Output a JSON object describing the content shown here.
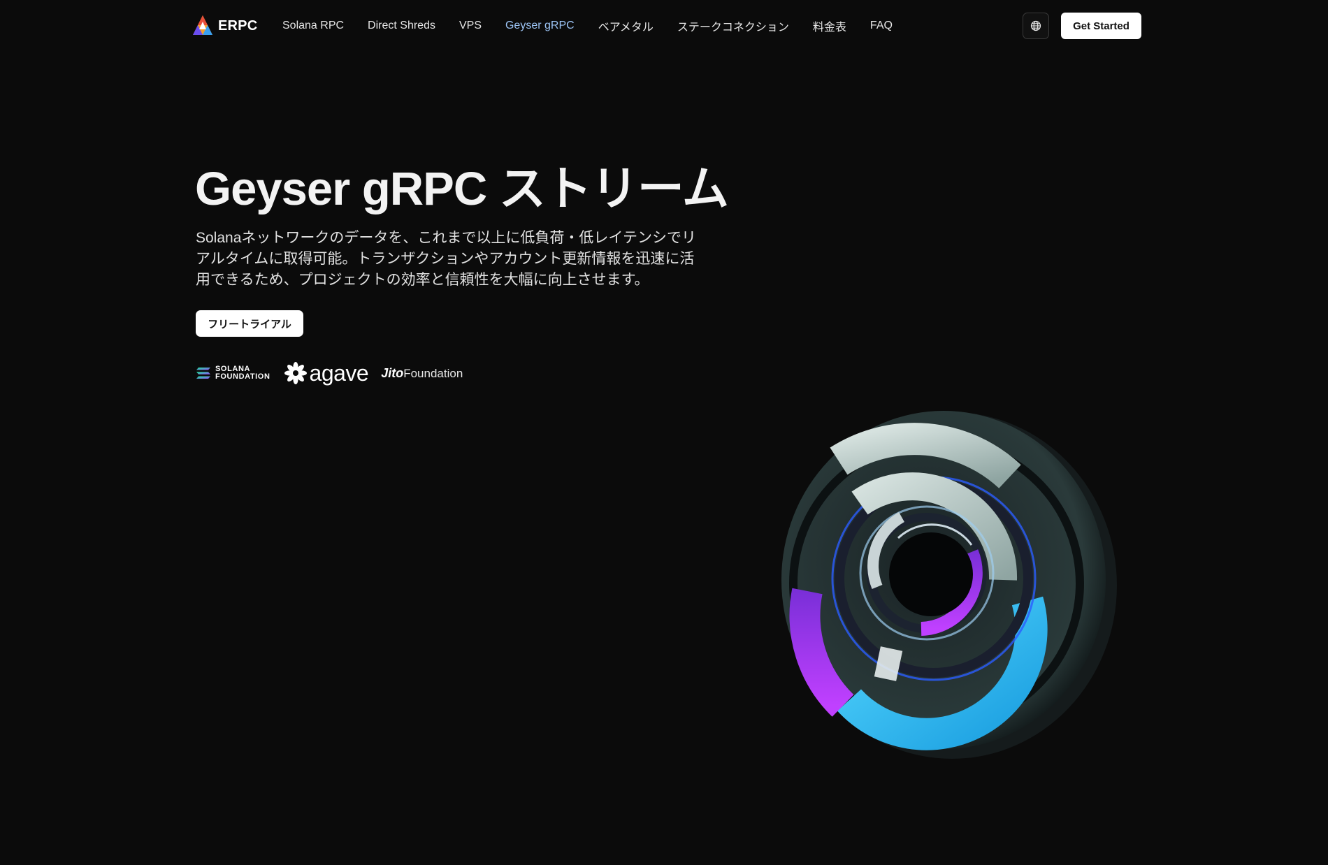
{
  "brand": {
    "name": "ERPC"
  },
  "nav": {
    "items": [
      {
        "label": "Solana RPC",
        "active": false
      },
      {
        "label": "Direct Shreds",
        "active": false
      },
      {
        "label": "VPS",
        "active": false
      },
      {
        "label": "Geyser gRPC",
        "active": true
      },
      {
        "label": "ベアメタル",
        "active": false
      },
      {
        "label": "ステークコネクション",
        "active": false
      },
      {
        "label": "料金表",
        "active": false
      },
      {
        "label": "FAQ",
        "active": false
      }
    ],
    "language_icon": "globe-icon",
    "cta_label": "Get Started"
  },
  "hero": {
    "title": "Geyser gRPC ストリーム",
    "description": "Solanaネットワークのデータを、これまで以上に低負荷・低レイテンシでリアルタイムに取得可能。トランザクションやアカウント更新情報を迅速に活用できるため、プロジェクトの効率と信頼性を大幅に向上させます。",
    "trial_label": "フリートライアル"
  },
  "partners": {
    "solana": {
      "line1": "SOLANA",
      "line2": "FOUNDATION"
    },
    "agave": {
      "name": "agave"
    },
    "jito": {
      "part1": "Jito",
      "part2": "Foundation"
    }
  },
  "colors": {
    "background": "#0b0b0b",
    "active_nav": "#9cc4f5",
    "button_bg": "#ffffff",
    "ring_cyan": "#22b8f0",
    "ring_purple": "#9b3df0",
    "ring_silver": "#b8c8c6"
  }
}
